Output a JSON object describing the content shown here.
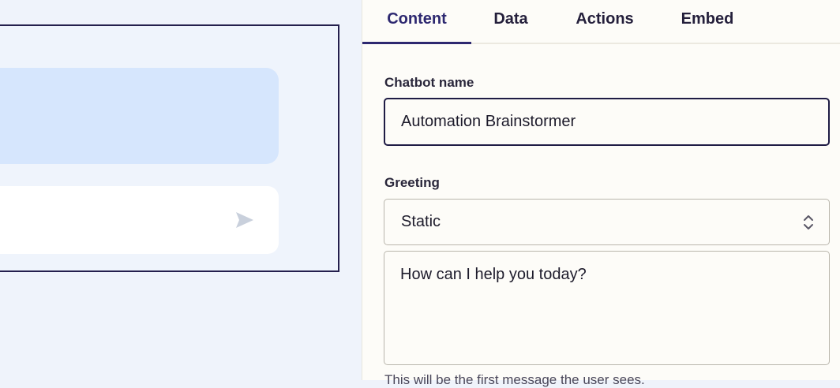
{
  "tabs": [
    {
      "label": "Content",
      "active": true
    },
    {
      "label": "Data",
      "active": false
    },
    {
      "label": "Actions",
      "active": false
    },
    {
      "label": "Embed",
      "active": false
    }
  ],
  "form": {
    "chatbot_name_label": "Chatbot name",
    "chatbot_name_value": "Automation Brainstormer",
    "greeting_label": "Greeting",
    "greeting_type": "Static",
    "greeting_message": "How can I help you today?",
    "greeting_helper": "This will be the first message the user sees."
  },
  "preview": {
    "send_icon": "send-icon"
  },
  "colors": {
    "accent": "#2d2870",
    "preview_background": "#eff3fb",
    "bubble": "#d6e6fd",
    "panel_background": "#fdfcf8"
  }
}
